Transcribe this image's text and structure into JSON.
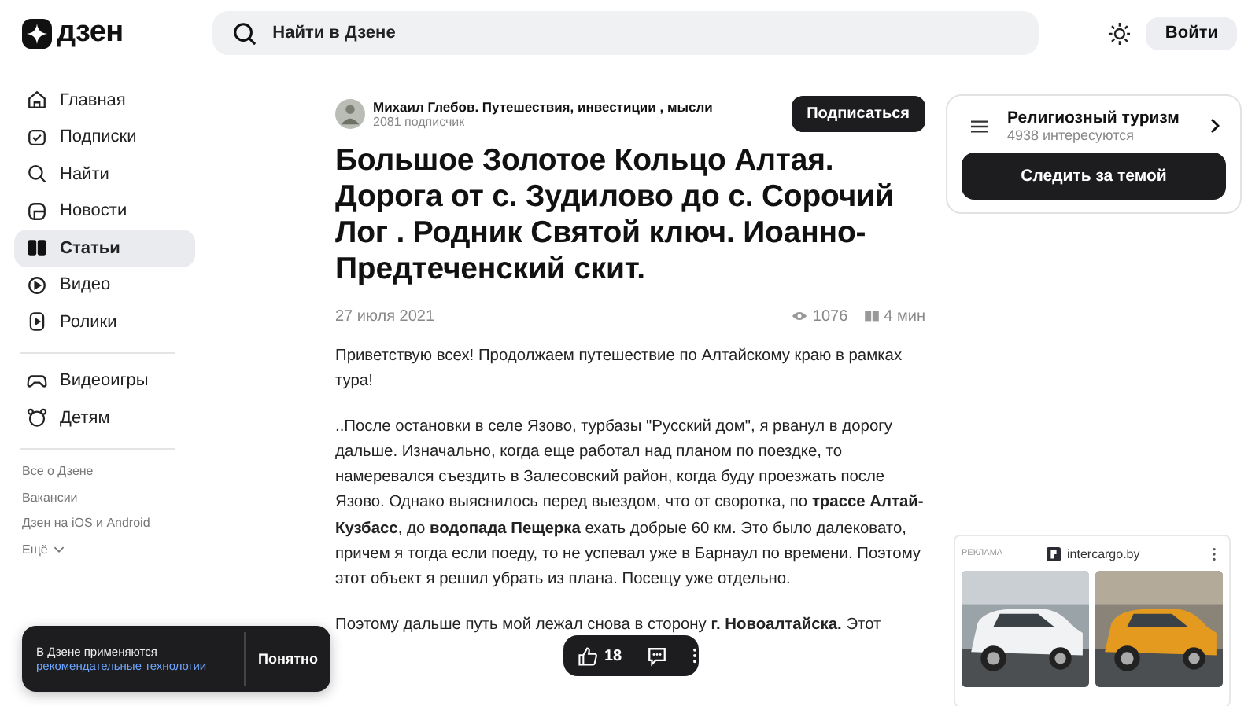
{
  "header": {
    "logo": "дзен",
    "search": {
      "placeholder": "Найти в Дзене"
    },
    "login": "Войти"
  },
  "sidebar": {
    "items": [
      {
        "label": "Главная",
        "selected": false
      },
      {
        "label": "Подписки",
        "selected": false
      },
      {
        "label": "Найти",
        "selected": false
      },
      {
        "label": "Новости",
        "selected": false
      },
      {
        "label": "Статьи",
        "selected": true
      },
      {
        "label": "Видео",
        "selected": false
      },
      {
        "label": "Ролики",
        "selected": false
      }
    ],
    "extra_items": [
      {
        "label": "Видеоигры",
        "selected": false
      },
      {
        "label": "Детям",
        "selected": false
      }
    ],
    "links": [
      "Все о Дзене",
      "Вакансии",
      "Дзен на iOS и Android"
    ],
    "more": "Ещё"
  },
  "article": {
    "author": "Михаил Глебов. Путешествия, инвестиции , мысли",
    "subscribers": "2081 подписчик",
    "subscribe": "Подписаться",
    "title": "Большое Золотое Кольцо Алтая. Дорога от с. Зудилово до с. Сорочий Лог . Родник Святой ключ. Иоанно- Предтеченский скит.",
    "date": "27 июля 2021",
    "views": "1076",
    "read_time": "4 мин",
    "paragraphs": [
      "Приветствую всех! Продолжаем путешествие по Алтайскому краю в рамках тура!",
      "..После остановки в селе Язово, турбазы \"Русский дом\", я рванул в дорогу дальше. Изначально, когда еще работал над планом по поездке, то намеревался съездить в Залесовский район, когда буду проезжать после Язово. Однако выяснилось перед выездом, что от своротка, по **трассе Алтай- Кузбасс**, до **водопада Пещерка** ехать добрые 60 км. Это было далековато, причем я тогда если поеду, то не успевал уже в Барнаул по времени. Поэтому этот объект я решил убрать из плана. Посещу уже отдельно.",
      "Поэтому дальше путь мой лежал снова в сторону **г. Новоалтайска.** Этот"
    ]
  },
  "topic": {
    "name": "Религиозный туризм",
    "followers": "4938 интересуются",
    "follow": "Следить за темой"
  },
  "ad": {
    "label": "РЕКЛАМА",
    "domain": "intercargo.by"
  },
  "cookie": {
    "text": "В Дзене применяются",
    "link": "рекомендательные технологии",
    "button": "Понятно"
  },
  "actions": {
    "likes": "18"
  }
}
